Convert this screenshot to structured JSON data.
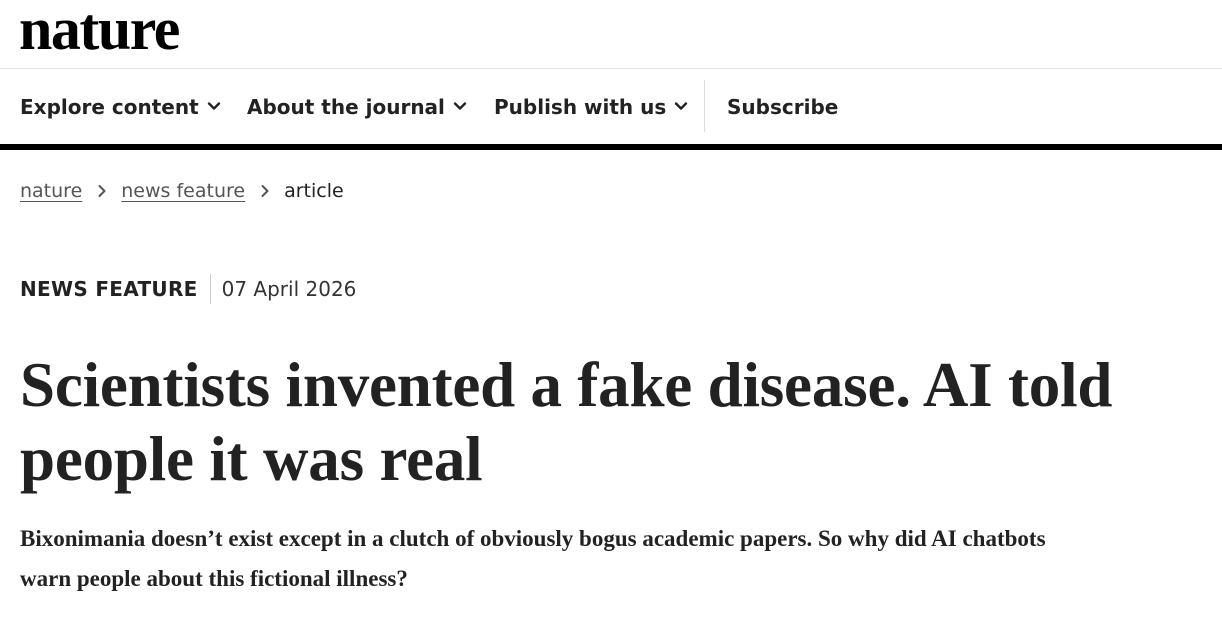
{
  "brand": {
    "logo_text": "nature"
  },
  "nav": {
    "items": [
      {
        "label": "Explore content",
        "icon": "chevron-down-icon"
      },
      {
        "label": "About the journal",
        "icon": "chevron-down-icon"
      },
      {
        "label": "Publish with us",
        "icon": "chevron-down-icon"
      }
    ],
    "subscribe_label": "Subscribe"
  },
  "breadcrumb": {
    "items": [
      {
        "label": "nature",
        "link": true
      },
      {
        "label": "news feature",
        "link": true
      },
      {
        "label": "article",
        "link": false
      }
    ],
    "separator_icon": "chevron-right-icon"
  },
  "article": {
    "type": "NEWS FEATURE",
    "date": "07 April 2026",
    "title": "Scientists invented a fake disease. AI told people it was real",
    "standfirst": "Bixonimania doesn’t exist except in a clutch of obviously bogus academic papers. So why did AI chatbots warn people about this fictional illness?"
  },
  "colors": {
    "text": "#222222",
    "nav_rule": "#000000",
    "link_gray": "#555555"
  }
}
